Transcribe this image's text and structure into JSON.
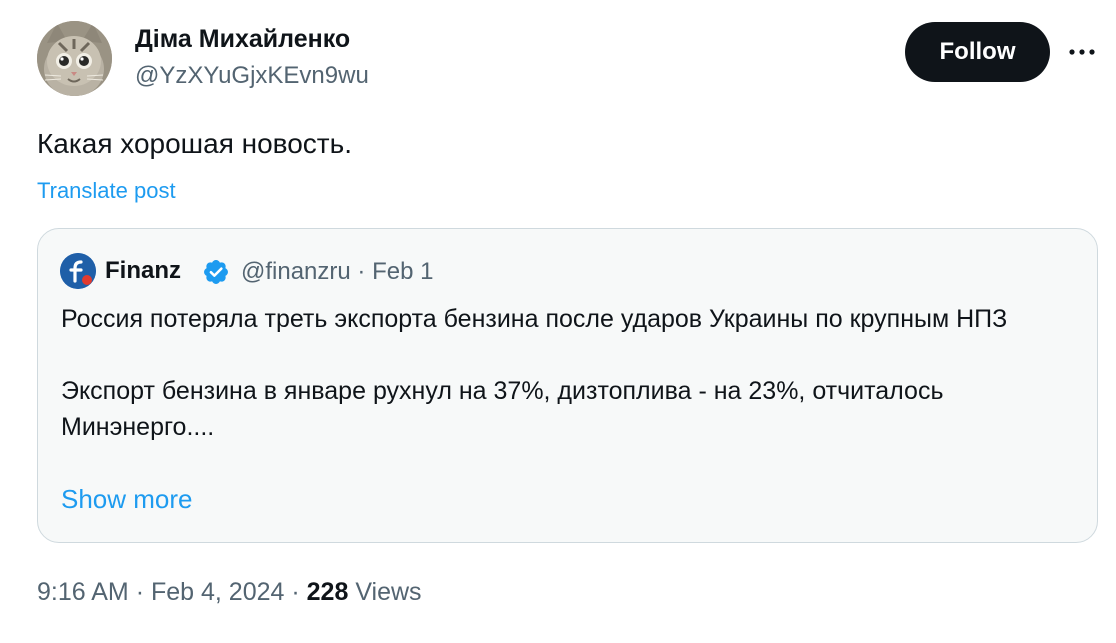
{
  "author": {
    "name": "Діма Михайленко",
    "handle": "@YzXYuGjxKEvn9wu",
    "avatar_icon": "cat-avatar"
  },
  "actions": {
    "follow_label": "Follow",
    "more_icon": "more-dots-icon"
  },
  "post": {
    "text": "Какая хорошая новость.",
    "translate_label": "Translate post"
  },
  "quote": {
    "name": "Finanz",
    "verified_icon": "verified-badge-icon",
    "handle": "@finanzru",
    "separator": "·",
    "date": "Feb 1",
    "text": "Россия потеряла треть экспорта бензина после ударов Украины по крупным НПЗ\n\nЭкспорт бензина в январе рухнул на 37%, дизтоплива - на 23%, отчиталось Минэнерго....",
    "show_more_label": "Show more"
  },
  "meta": {
    "time": "9:16 AM",
    "separator": "·",
    "date": "Feb 4, 2024",
    "views_count": "228",
    "views_label": "Views"
  },
  "colors": {
    "accent": "#1d9bf0",
    "text_primary": "#0f1419",
    "text_secondary": "#536471",
    "border": "#cfd9de",
    "card_bg": "#f7f9f9"
  }
}
